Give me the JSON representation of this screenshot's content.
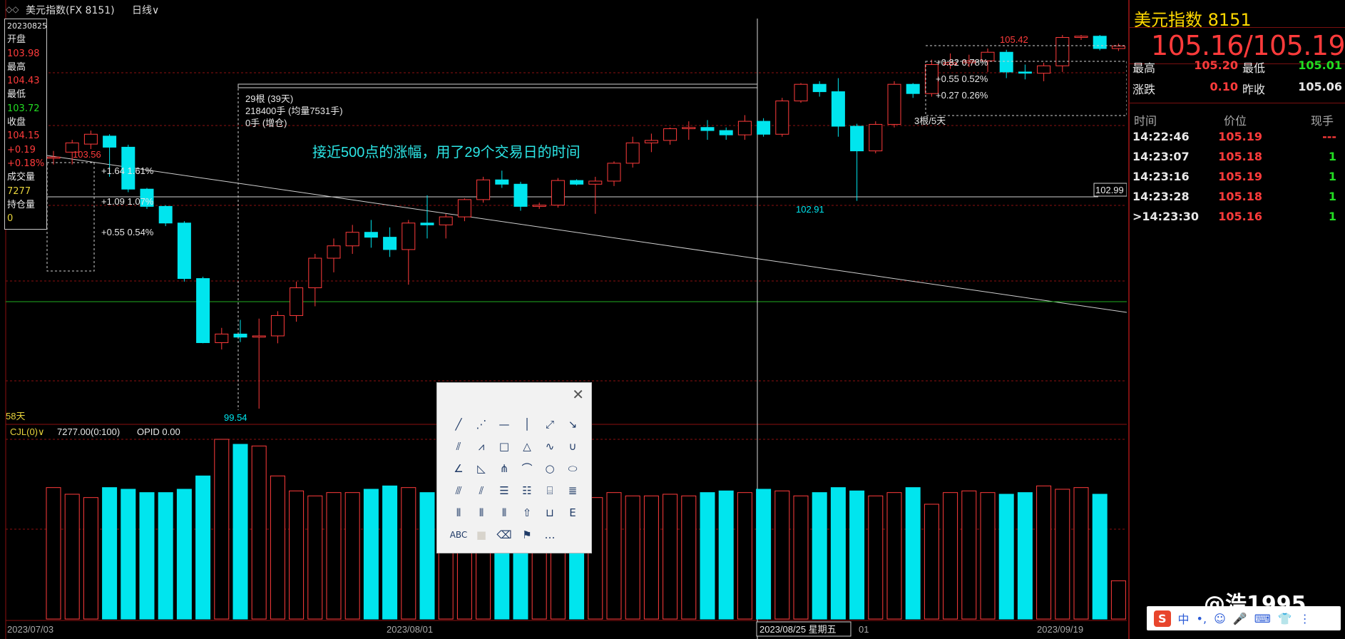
{
  "window": {
    "title": "美元指数(FX 8151)",
    "period": "日线∨",
    "icon": "double-chevron-icon"
  },
  "infobox": {
    "date": "20230825",
    "open_label": "开盘",
    "open": "103.98",
    "high_label": "最高",
    "high": "104.43",
    "low_label": "最低",
    "low": "103.72",
    "close_label": "收盘",
    "close": "104.15",
    "change": "+0.19",
    "change_pct": "+0.18%",
    "volume_label": "成交量",
    "volume": "7277",
    "oi_label": "持仓量",
    "oi": "0"
  },
  "chart_data": {
    "type": "candlestick",
    "x_ticks": [
      "2023/07/03",
      "2023/08/01",
      "2023/08/25 星期五",
      "01",
      "2023/09/19"
    ],
    "candles": [
      {
        "o": 103.6,
        "h": 103.72,
        "l": 103.5,
        "c": 103.62
      },
      {
        "o": 103.7,
        "h": 103.9,
        "l": 103.5,
        "c": 103.85
      },
      {
        "o": 103.83,
        "h": 104.05,
        "l": 103.75,
        "c": 103.99
      },
      {
        "o": 103.96,
        "h": 103.99,
        "l": 103.3,
        "c": 103.78
      },
      {
        "o": 103.78,
        "h": 103.82,
        "l": 103.05,
        "c": 103.1
      },
      {
        "o": 103.1,
        "h": 103.12,
        "l": 102.78,
        "c": 102.82
      },
      {
        "o": 102.82,
        "h": 102.84,
        "l": 102.5,
        "c": 102.55
      },
      {
        "o": 102.55,
        "h": 102.58,
        "l": 101.6,
        "c": 101.65
      },
      {
        "o": 101.65,
        "h": 101.68,
        "l": 100.6,
        "c": 100.61
      },
      {
        "o": 100.61,
        "h": 100.85,
        "l": 100.5,
        "c": 100.75
      },
      {
        "o": 100.75,
        "h": 100.98,
        "l": 100.62,
        "c": 100.7
      },
      {
        "o": 100.7,
        "h": 101.0,
        "l": 99.54,
        "c": 100.72
      },
      {
        "o": 100.72,
        "h": 101.12,
        "l": 100.6,
        "c": 101.05
      },
      {
        "o": 101.05,
        "h": 101.6,
        "l": 100.95,
        "c": 101.5
      },
      {
        "o": 101.5,
        "h": 102.05,
        "l": 101.2,
        "c": 101.98
      },
      {
        "o": 101.98,
        "h": 102.3,
        "l": 101.75,
        "c": 102.18
      },
      {
        "o": 102.18,
        "h": 102.52,
        "l": 102.05,
        "c": 102.4
      },
      {
        "o": 102.4,
        "h": 102.6,
        "l": 102.15,
        "c": 102.32
      },
      {
        "o": 102.32,
        "h": 102.48,
        "l": 102.0,
        "c": 102.12
      },
      {
        "o": 102.12,
        "h": 102.6,
        "l": 101.55,
        "c": 102.55
      },
      {
        "o": 102.55,
        "h": 103.0,
        "l": 102.3,
        "c": 102.52
      },
      {
        "o": 102.52,
        "h": 102.7,
        "l": 102.3,
        "c": 102.65
      },
      {
        "o": 102.65,
        "h": 102.95,
        "l": 102.58,
        "c": 102.93
      },
      {
        "o": 102.93,
        "h": 103.3,
        "l": 102.88,
        "c": 103.25
      },
      {
        "o": 103.25,
        "h": 103.4,
        "l": 103.12,
        "c": 103.18
      },
      {
        "o": 103.18,
        "h": 103.22,
        "l": 102.75,
        "c": 102.82
      },
      {
        "o": 102.82,
        "h": 102.88,
        "l": 102.78,
        "c": 102.84
      },
      {
        "o": 102.84,
        "h": 103.28,
        "l": 102.8,
        "c": 103.24
      },
      {
        "o": 103.24,
        "h": 103.26,
        "l": 103.16,
        "c": 103.18
      },
      {
        "o": 103.18,
        "h": 103.3,
        "l": 102.7,
        "c": 103.23
      },
      {
        "o": 103.23,
        "h": 103.55,
        "l": 103.15,
        "c": 103.52
      },
      {
        "o": 103.52,
        "h": 103.95,
        "l": 103.45,
        "c": 103.85
      },
      {
        "o": 103.85,
        "h": 104.0,
        "l": 103.7,
        "c": 103.89
      },
      {
        "o": 103.89,
        "h": 104.1,
        "l": 103.82,
        "c": 104.08
      },
      {
        "o": 104.08,
        "h": 104.2,
        "l": 103.9,
        "c": 104.1
      },
      {
        "o": 104.1,
        "h": 104.22,
        "l": 103.9,
        "c": 104.05
      },
      {
        "o": 104.05,
        "h": 104.1,
        "l": 103.9,
        "c": 103.98
      },
      {
        "o": 103.98,
        "h": 104.3,
        "l": 103.9,
        "c": 104.2
      },
      {
        "o": 104.2,
        "h": 104.25,
        "l": 103.95,
        "c": 103.99
      },
      {
        "o": 103.99,
        "h": 104.58,
        "l": 103.95,
        "c": 104.53
      },
      {
        "o": 104.53,
        "h": 104.82,
        "l": 104.5,
        "c": 104.8
      },
      {
        "o": 104.8,
        "h": 104.85,
        "l": 104.6,
        "c": 104.68
      },
      {
        "o": 104.68,
        "h": 104.9,
        "l": 103.95,
        "c": 104.12
      },
      {
        "o": 104.12,
        "h": 104.16,
        "l": 102.91,
        "c": 103.72
      },
      {
        "o": 103.72,
        "h": 104.2,
        "l": 103.68,
        "c": 104.15
      },
      {
        "o": 104.15,
        "h": 104.85,
        "l": 104.1,
        "c": 104.8
      },
      {
        "o": 104.8,
        "h": 104.82,
        "l": 104.58,
        "c": 104.65
      },
      {
        "o": 104.65,
        "h": 105.2,
        "l": 104.6,
        "c": 105.12
      },
      {
        "o": 105.12,
        "h": 105.3,
        "l": 105.05,
        "c": 105.15
      },
      {
        "o": 105.15,
        "h": 105.28,
        "l": 105.08,
        "c": 105.18
      },
      {
        "o": 105.18,
        "h": 105.38,
        "l": 105.0,
        "c": 105.32
      },
      {
        "o": 105.32,
        "h": 105.36,
        "l": 104.9,
        "c": 105.0
      },
      {
        "o": 105.0,
        "h": 105.12,
        "l": 104.88,
        "c": 104.98
      },
      {
        "o": 104.98,
        "h": 105.15,
        "l": 104.85,
        "c": 105.1
      },
      {
        "o": 105.1,
        "h": 105.6,
        "l": 105.0,
        "c": 105.56
      },
      {
        "o": 105.56,
        "h": 105.6,
        "l": 105.52,
        "c": 105.58
      },
      {
        "o": 105.58,
        "h": 105.6,
        "l": 105.35,
        "c": 105.38
      },
      {
        "o": 105.38,
        "h": 105.46,
        "l": 105.34,
        "c": 105.42
      }
    ],
    "volumes": [
      7900,
      7500,
      7300,
      7900,
      7800,
      7600,
      7600,
      7800,
      8600,
      10800,
      10500,
      10400,
      8600,
      7700,
      7400,
      7600,
      7600,
      7800,
      8000,
      7900,
      7600,
      7700,
      7500,
      7300,
      7600,
      7400,
      7500,
      7100,
      7400,
      7300,
      7600,
      7400,
      7400,
      7500,
      7400,
      7600,
      7700,
      7600,
      7800,
      7700,
      7400,
      7600,
      7900,
      7700,
      7400,
      7600,
      7900,
      6900,
      7600,
      7700,
      7600,
      7500,
      7600,
      8000,
      7800,
      7900,
      7500,
      2300
    ],
    "annotations": {
      "high_mark": "105.42",
      "low_mark": "99.54",
      "left_high": "103.56",
      "recent_low": "102.91",
      "price_tag": "102.99",
      "days_label": "58天",
      "measure_left": [
        "+1.64  1.61%",
        "+1.09  1.07%",
        "+0.55  0.54%"
      ],
      "measure_right": [
        "+0.82  0.78%",
        "+0.55  0.52%",
        "+0.27  0.26%"
      ],
      "measure_right_label": "3根/5天",
      "range_lines": [
        "29根 (39天)",
        "218400手 (均量7531手)",
        "0手 (增仓)"
      ],
      "note": "接近500点的涨幅，用了29个交易日的时间"
    },
    "volume_header": {
      "name": "CJL(0)∨",
      "value": "7277.00(0:100)",
      "opid": "OPID 0.00"
    }
  },
  "colors": {
    "up": "#ff3b3b",
    "down": "#00e5ee",
    "grid": "#8b1010",
    "line": "#d8d8d8",
    "green_line": "#1fae1f"
  },
  "quote": {
    "name": "美元指数  8151",
    "price": "105.16/105.19",
    "high_label": "最高",
    "high": "105.20",
    "low_label": "最低",
    "low": "105.01",
    "chg_label": "涨跌",
    "chg": "0.10",
    "prev_label": "昨收",
    "prev": "105.06",
    "col_time": "时间",
    "col_price": "价位",
    "col_qty": "现手",
    "ticks": [
      {
        "time": "14:22:46",
        "price": "105.19",
        "qty": "---"
      },
      {
        "time": "14:23:07",
        "price": "105.18",
        "qty": "1"
      },
      {
        "time": "14:23:16",
        "price": "105.19",
        "qty": "1"
      },
      {
        "time": "14:23:28",
        "price": "105.18",
        "qty": "1"
      },
      {
        "time": ">14:23:30",
        "price": "105.16",
        "qty": "1"
      }
    ]
  },
  "toolbox": {
    "close": "✕",
    "tools": [
      {
        "name": "line-tool-icon",
        "glyph": "╱"
      },
      {
        "name": "dashed-line-tool-icon",
        "glyph": "⋰"
      },
      {
        "name": "horizontal-line-tool-icon",
        "glyph": "—"
      },
      {
        "name": "vertical-line-tool-icon",
        "glyph": "│"
      },
      {
        "name": "segment-tool-icon",
        "glyph": "⤢"
      },
      {
        "name": "arrow-tool-icon",
        "glyph": "↘"
      },
      {
        "name": "parallel-line-tool-icon",
        "glyph": "⫽"
      },
      {
        "name": "zigzag-tool-icon",
        "glyph": "⩘"
      },
      {
        "name": "rectangle-tool-icon",
        "glyph": "□"
      },
      {
        "name": "triangle-tool-icon",
        "glyph": "△"
      },
      {
        "name": "wave-tool-icon",
        "glyph": "∿"
      },
      {
        "name": "cup-tool-icon",
        "glyph": "∪"
      },
      {
        "name": "gann-angle-tool-icon",
        "glyph": "∠"
      },
      {
        "name": "angle-fan-tool-icon",
        "glyph": "◺"
      },
      {
        "name": "pitchfork-tool-icon",
        "glyph": "⋔"
      },
      {
        "name": "arc-tool-icon",
        "glyph": "⌒"
      },
      {
        "name": "circle-tool-icon",
        "glyph": "○"
      },
      {
        "name": "ellipse-tool-icon",
        "glyph": "⬭"
      },
      {
        "name": "fan-tool-icon",
        "glyph": "⫻"
      },
      {
        "name": "speed-line-tool-icon",
        "glyph": "⫽"
      },
      {
        "name": "fibonacci-tool-icon",
        "glyph": "☰"
      },
      {
        "name": "percent-tool-icon",
        "glyph": "☷"
      },
      {
        "name": "gann-box-tool-icon",
        "glyph": "⌸"
      },
      {
        "name": "channel-tool-icon",
        "glyph": "≣"
      },
      {
        "name": "cycle-line-tool-icon",
        "glyph": "⦀"
      },
      {
        "name": "fib-time-tool-icon",
        "glyph": "⦀"
      },
      {
        "name": "time-ruler-tool-icon",
        "glyph": "⦀"
      },
      {
        "name": "up-arrow-tool-icon",
        "glyph": "⇧"
      },
      {
        "name": "ruler-tool-icon",
        "glyph": "⊔"
      },
      {
        "name": "scale-tool-icon",
        "glyph": "E"
      },
      {
        "name": "text-tool-icon",
        "glyph": "ABC"
      },
      {
        "name": "color-tool-icon",
        "glyph": "■"
      },
      {
        "name": "eraser-tool-icon",
        "glyph": "⌫"
      },
      {
        "name": "flag-tool-icon",
        "glyph": "⚑"
      },
      {
        "name": "more-tool-icon",
        "glyph": "…"
      }
    ]
  },
  "watermark": "@浩1995",
  "ime": [
    "S",
    "中",
    "•,",
    "☺",
    "🎤",
    "⌨",
    "👕",
    "⋮"
  ]
}
